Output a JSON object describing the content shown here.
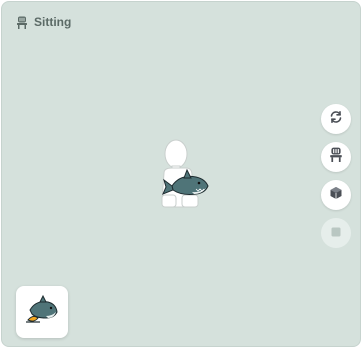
{
  "header": {
    "mode_label": "Sitting",
    "mode_icon": "chair-icon"
  },
  "preview": {
    "avatar": "avatar-figure",
    "held_item": "shark-item"
  },
  "controls": [
    {
      "name": "rotate-button",
      "icon": "rotate-icon",
      "enabled": true
    },
    {
      "name": "sit-toggle-button",
      "icon": "chair-icon",
      "enabled": true
    },
    {
      "name": "furniture-button",
      "icon": "cube-icon",
      "enabled": true
    },
    {
      "name": "stop-button",
      "icon": "stop-icon",
      "enabled": false
    }
  ],
  "selected_item": {
    "icon": "shark-item-icon"
  },
  "colors": {
    "background": "#d5e1dc",
    "icon": "#4b4f56",
    "disabled_icon": "#b9c7c2",
    "shark": "#4f7478"
  }
}
